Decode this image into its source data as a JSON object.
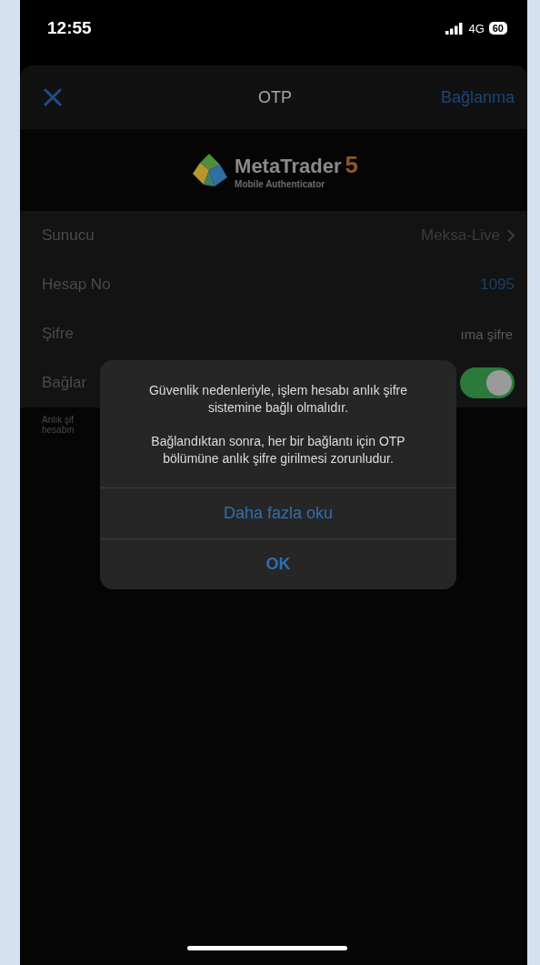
{
  "status_bar": {
    "time": "12:55",
    "network": "4G",
    "battery": "60"
  },
  "nav": {
    "title": "OTP",
    "action": "Bağlanma"
  },
  "logo": {
    "brand": "MetaTrader",
    "version": "5",
    "subtitle": "Mobile Authenticator"
  },
  "rows": [
    {
      "kind": "link",
      "label": "Sunucu",
      "value": "Meksa-Live"
    },
    {
      "kind": "value",
      "label": "Hesap No",
      "value": "1095"
    },
    {
      "kind": "field",
      "label": "Şifre",
      "placeholder": "ıma şifre"
    },
    {
      "kind": "toggle",
      "label": "Bağlar",
      "on": true
    }
  ],
  "note_lines": [
    "Anlık şif",
    "hesabın"
  ],
  "dialog": {
    "message": [
      "Güvenlik nedenleriyle, işlem hesabı anlık şifre sistemine bağlı olmalıdır.",
      "Bağlandıktan sonra, her bir bağlantı için OTP bölümüne anlık şifre girilmesi zorunludur."
    ],
    "buttons": [
      {
        "kind": "default",
        "label": "Daha fazla oku"
      },
      {
        "kind": "primary",
        "label": "OK"
      }
    ]
  }
}
